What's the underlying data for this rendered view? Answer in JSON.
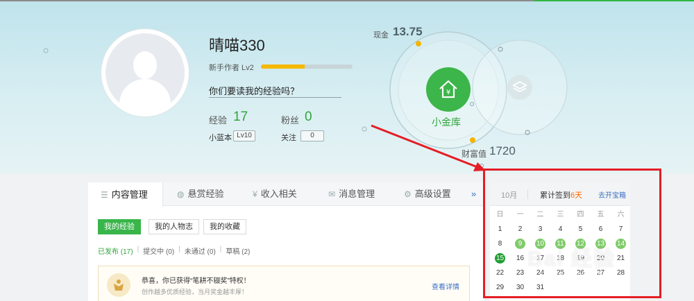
{
  "profile": {
    "username": "晴喵330",
    "level_label": "新手作者 Lv2",
    "level_progress": 0.48,
    "motto": "你们要读我的经验吗？",
    "experience_label": "经验",
    "experience_value": "17",
    "fans_label": "粉丝",
    "fans_value": "0",
    "bluebook_label": "小蓝本",
    "bluebook_level": "Lv10",
    "follow_label": "关注",
    "follow_count": "0"
  },
  "vault": {
    "cash_label": "现金",
    "cash_value": "13.75",
    "vault_label": "小金库",
    "wealth_label": "财富值",
    "wealth_value": "1720",
    "accent": "#3cb54a"
  },
  "tabs": [
    {
      "label": "内容管理",
      "icon": "list-icon"
    },
    {
      "label": "悬赏经验",
      "icon": "coin-icon"
    },
    {
      "label": "收入相关",
      "icon": "yen-icon"
    },
    {
      "label": "消息管理",
      "icon": "mail-icon"
    },
    {
      "label": "高级设置",
      "icon": "gear-icon"
    }
  ],
  "tabs_more": "»",
  "subtabs": [
    "我的经验",
    "我的人物志",
    "我的收藏"
  ],
  "filters": {
    "published": "已发布 (17)",
    "submitting": "提交中 (0)",
    "rejected": "未通过 (0)",
    "drafts": "草稿 (2)"
  },
  "notice": {
    "title": "恭喜，你已获得“笔耕不辍奖”特权！",
    "subtitle": "创作越多优质经验，当月奖金越丰厚！",
    "link": "查看详情"
  },
  "calendar": {
    "month": "10月",
    "signin_prefix": "累计签到",
    "signin_days": "6天",
    "treasure_link": "去开宝箱",
    "weekdays": [
      "日",
      "一",
      "二",
      "三",
      "四",
      "五",
      "六"
    ],
    "days": [
      [
        "1",
        "2",
        "3",
        "4",
        "5",
        "6",
        "7"
      ],
      [
        "8",
        "9",
        "10",
        "11",
        "12",
        "13",
        "14"
      ],
      [
        "15",
        "16",
        "17",
        "18",
        "19",
        "20",
        "21"
      ],
      [
        "22",
        "23",
        "24",
        "25",
        "26",
        "27",
        "28"
      ],
      [
        "29",
        "30",
        "31"
      ]
    ],
    "signed_days": [
      "9",
      "10",
      "11",
      "12",
      "13",
      "14"
    ],
    "today": "15",
    "signed_color": "#7fcb6a",
    "today_color": "#1f9f33"
  },
  "watermark": {
    "main": "Bai 经验",
    "sub": "jingyan.baidu.com"
  }
}
